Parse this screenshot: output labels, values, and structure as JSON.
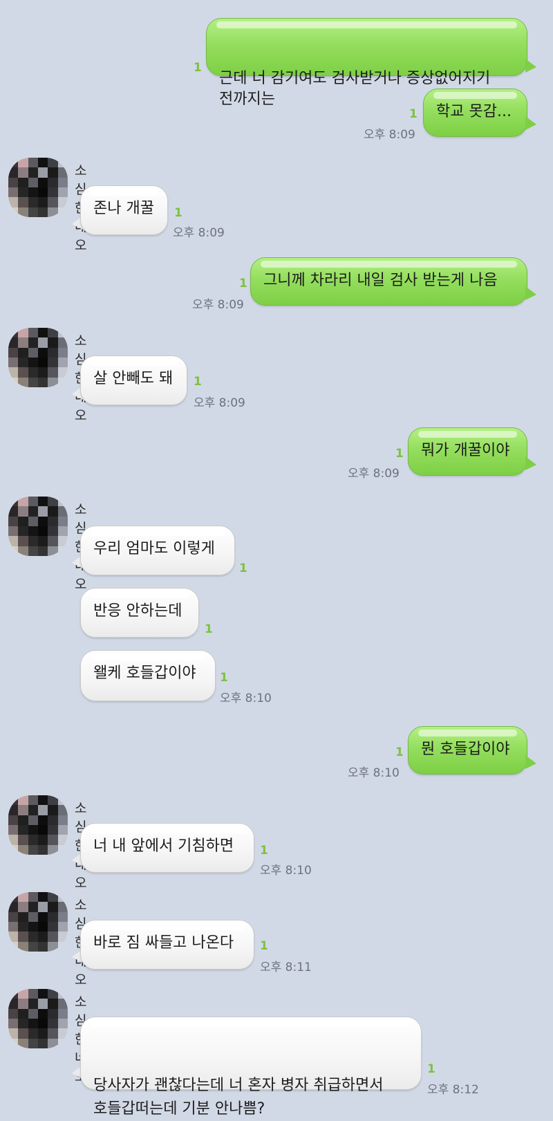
{
  "contact_name": "소심한 네오",
  "read_count": "1",
  "messages": [
    {
      "side": "sent",
      "text": "근데 너 감기여도 검사받거나 증상없어지기\n전까지는",
      "time": ""
    },
    {
      "side": "sent",
      "text": "학교 못감...",
      "time": "오후 8:09"
    },
    {
      "side": "recv",
      "sender": "소심한 네오",
      "text": "존나 개꿀",
      "time": "오후 8:09"
    },
    {
      "side": "sent",
      "text": "그니께 차라리 내일 검사 받는게 나음",
      "time": "오후 8:09"
    },
    {
      "side": "recv",
      "sender": "소심한 네오",
      "text": "살 안빼도 돼",
      "time": "오후 8:09"
    },
    {
      "side": "sent",
      "text": "뭐가 개꿀이야",
      "time": "오후 8:09"
    },
    {
      "side": "recv",
      "sender": "소심한 네오",
      "text": "우리 엄마도 이렇게",
      "time": ""
    },
    {
      "side": "recv",
      "text": "반응 안하는데",
      "time": ""
    },
    {
      "side": "recv",
      "text": "왤케 호들갑이야",
      "time": "오후 8:10"
    },
    {
      "side": "sent",
      "text": "뭔 호들갑이야",
      "time": "오후 8:10"
    },
    {
      "side": "recv",
      "sender": "소심한 네오",
      "text": "너 내 앞에서 기침하면",
      "time": "오후 8:10"
    },
    {
      "side": "recv",
      "sender": "소심한 네오",
      "text": "바로 짐 싸들고 나온다",
      "time": "오후 8:11"
    },
    {
      "side": "recv",
      "sender": "소심한 네오",
      "text": "당사자가 괜찮다는데 너 혼자 병자 취급하면서\n호들갑떠는데 기분 안나쁨?",
      "time": "오후 8:12"
    }
  ],
  "colors": {
    "background": "#d2d9e6",
    "sent_bubble": "#94de5e",
    "recv_bubble": "#f5f5f5",
    "read_indicator": "#7cc23f",
    "timestamp": "#6b7180"
  }
}
